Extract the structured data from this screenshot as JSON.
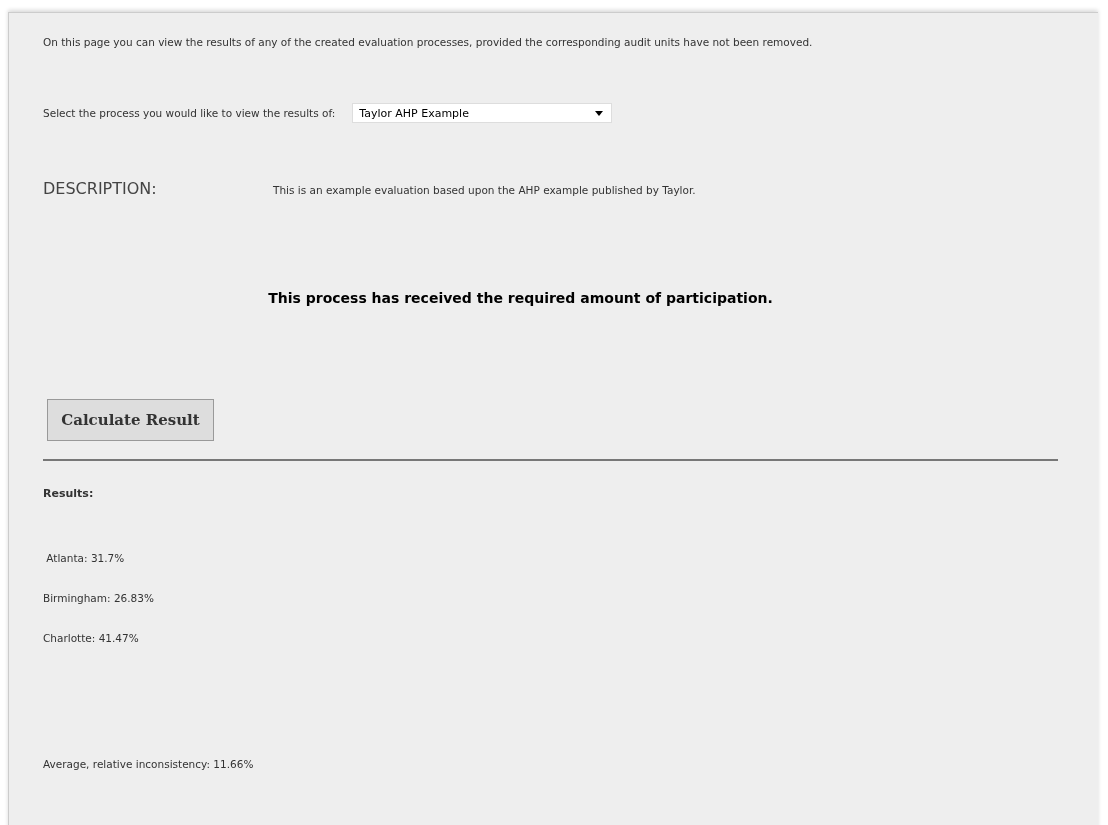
{
  "intro": "On this page you can view the results of any of the created evaluation processes, provided the corresponding audit units have not been removed.",
  "process_select": {
    "label": "Select the process you would like to view the results of:",
    "value": "Taylor AHP Example"
  },
  "description": {
    "heading": "DESCRIPTION:",
    "text": "This is an example evaluation based upon the AHP example published by Taylor."
  },
  "participation_message": "This process has received the required amount of participation.",
  "calculate_button": "Calculate Result",
  "results": {
    "heading": "Results:",
    "items": [
      " Atlanta: 31.7%",
      "Birmingham: 26.83%",
      "Charlotte: 41.47%"
    ],
    "inconsistency": "Average, relative inconsistency: 11.66%"
  }
}
